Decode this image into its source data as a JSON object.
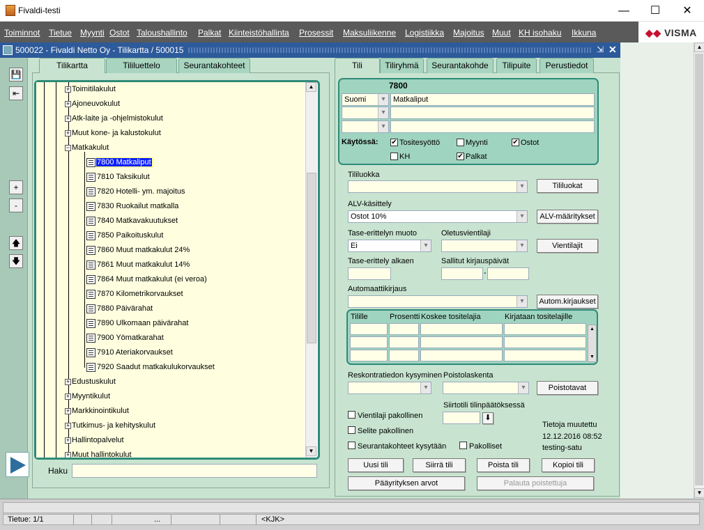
{
  "window": {
    "title": "Fivaldi-testi"
  },
  "menu": [
    "Toiminnot",
    "Tietue",
    "Myynti",
    "Ostot",
    "Taloushallinto",
    "Palkat",
    "Kiinteistöhallinta",
    "Prosessit",
    "Maksuliikenne",
    "Logistiikka",
    "Majoitus",
    "Muut",
    "KH isohaku",
    "Ikkuna"
  ],
  "brand": "VISMA",
  "inner": {
    "title": "500022 - Fivaldi Netto Oy - Tilikartta / 500015"
  },
  "left_tabs": [
    "Tilikartta",
    "Tililuettelo",
    "Seurantakohteet"
  ],
  "right_tabs": [
    "Tili",
    "Tiliryhmä",
    "Seurantakohde",
    "Tilipuite",
    "Perustiedot"
  ],
  "tree": {
    "groups_before": [
      "Toimitilakulut",
      "Ajoneuvokulut",
      "Atk-laite ja -ohjelmistokulut",
      "Muut kone- ja kalustokulut",
      "Matkakulut"
    ],
    "accounts": [
      "7800 Matkaliput",
      "7810 Taksikulut",
      "7820 Hotelli- ym. majoitus",
      "7830 Ruokailut matkalla",
      "7840 Matkavakuutukset",
      "7850 Paikoituskulut",
      "7860 Muut matkakulut 24%",
      "7861 Muut matkakulut 14%",
      "7864 Muut matkakulut (ei veroa)",
      "7870 Kilometrikorvaukset",
      "7880 Päivärahat",
      "7890 Ulkomaan päivärahat",
      "7900 Yömatkarahat",
      "7910 Ateriakorvaukset",
      "7920 Saadut matkakulukorvaukset"
    ],
    "groups_after": [
      "Edustuskulut",
      "Myyntikulut",
      "Markkinointikulut",
      "Tutkimus- ja kehityskulut",
      "Hallintopalvelut",
      "Muut hallintokulut"
    ],
    "pm_open": "−",
    "pm_closed": "+"
  },
  "search": {
    "label": "Haku",
    "value": ""
  },
  "account": {
    "number": "7800",
    "language": "Suomi",
    "name": "Matkaliput",
    "in_use_label": "Käytössä:",
    "checks": [
      {
        "label": "Tositesyöttö",
        "checked": true
      },
      {
        "label": "Myynti",
        "checked": false
      },
      {
        "label": "Ostot",
        "checked": true
      },
      {
        "label": "KH",
        "checked": false
      },
      {
        "label": "Palkat",
        "checked": true
      }
    ]
  },
  "form": {
    "tililuokka_label": "Tililuokka",
    "tililuokka_value": "",
    "tililuokat_btn": "Tililuokat",
    "alv_label": "ALV-käsittely",
    "alv_value": "Ostot 10%",
    "alv_btn": "ALV-määritykset",
    "tase_label": "Tase-erittelyn muoto",
    "tase_value": "Ei",
    "oletus_label": "Oletusvientilaji",
    "oletus_value": "",
    "vientilajit_btn": "Vientilajit",
    "tase_alkaen_label": "Tase-erittely alkaen",
    "sallitut_label": "Sallitut kirjauspäivät",
    "date_sep": "-",
    "auto_label": "Automaattikirjaus",
    "auto_btn": "Autom.kirjaukset",
    "grid_headers": [
      "Tilille",
      "Prosentti",
      "Koskee tositelajia",
      "Kirjataan tositelajille"
    ],
    "resk_label": "Reskontratiedon kysyminen",
    "poisto_label": "Poistolaskenta",
    "poistotavat_btn": "Poistotavat",
    "siirtotili_label": "Siirtotili tilinpäätöksessä",
    "vientilaji_pak": "Vientilaji pakollinen",
    "selite_pak": "Selite pakollinen",
    "seuranta_kys": "Seurantakohteet kysytään",
    "pakolliset": "Pakolliset",
    "changed_label": "Tietoja muutettu",
    "changed_date": "12.12.2016 08:52",
    "changed_user": "testing-satu"
  },
  "buttons": {
    "new": "Uusi tili",
    "move": "Siirrä tili",
    "delete": "Poista tili",
    "copy": "Kopioi tili",
    "parent": "Pääyrityksen arvot",
    "restore": "Palauta poistettuja"
  },
  "status": {
    "record": "Tietue: 1/1",
    "dots": "...",
    "mode": "<KJK>"
  },
  "colors": {
    "menubar": "#5a5a5a",
    "inner_title": "#2d5a9a",
    "panel": "#c8e4d0",
    "accent": "#2e8b78",
    "selection": "#0a1eff"
  }
}
